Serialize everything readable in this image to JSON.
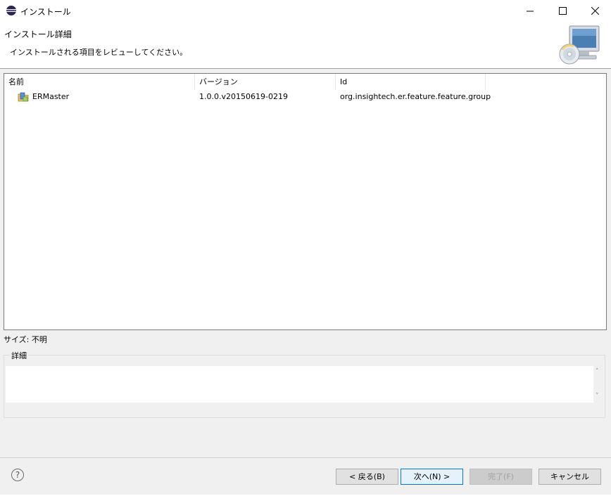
{
  "window": {
    "title": "インストール",
    "controls": {
      "minimize": "minimize-icon",
      "maximize": "maximize-icon",
      "close": "close-icon"
    }
  },
  "banner": {
    "heading": "インストール詳細",
    "subtitle": "インストールされる項目をレビューしてください。",
    "image": "install-wizard-computer-cd-icon"
  },
  "table": {
    "columns": [
      "名前",
      "バージョン",
      "Id"
    ],
    "rows": [
      {
        "icon": "feature-package-icon",
        "name": "ERMaster",
        "version": "1.0.0.v20150619-0219",
        "id": "org.insightech.er.feature.feature.group"
      }
    ]
  },
  "size_label": "サイズ: 不明",
  "details": {
    "label": "詳細",
    "content": ""
  },
  "footer": {
    "help_icon": "help-icon",
    "buttons": {
      "back": "< 戻る(B)",
      "next": "次へ(N) >",
      "finish": "完了(F)",
      "cancel": "キャンセル"
    }
  },
  "colors": {
    "accent": "#0078d7",
    "disabled_text": "#a0a0a0"
  }
}
